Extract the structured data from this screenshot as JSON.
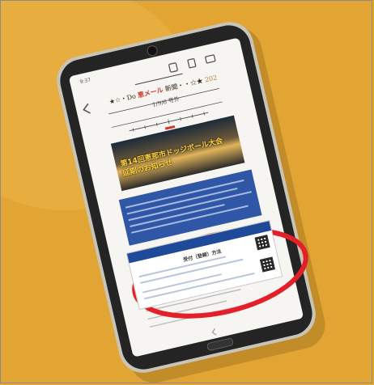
{
  "status_bar": {
    "time": "9:37"
  },
  "newsletter": {
    "title_prefix": "★☆・Do ",
    "title_accent": "恵メール",
    "title_suffix": " 新聞・・☆★ ",
    "issue_count": "202",
    "date": "1/9/6 号外"
  },
  "banner": {
    "line1": "第14回恵那市ドッジボール大会",
    "line2": "延期のお知らせ"
  },
  "card": {
    "center_label": "受付（登録）方法"
  },
  "colors": {
    "background": "#e2a432",
    "phone_body": "#2a2a2a",
    "phone_bezel": "#c9c4b8",
    "highlight_ellipse": "#e3202a",
    "accent_red": "#d4362a",
    "blue_box": "#2f57a6"
  }
}
